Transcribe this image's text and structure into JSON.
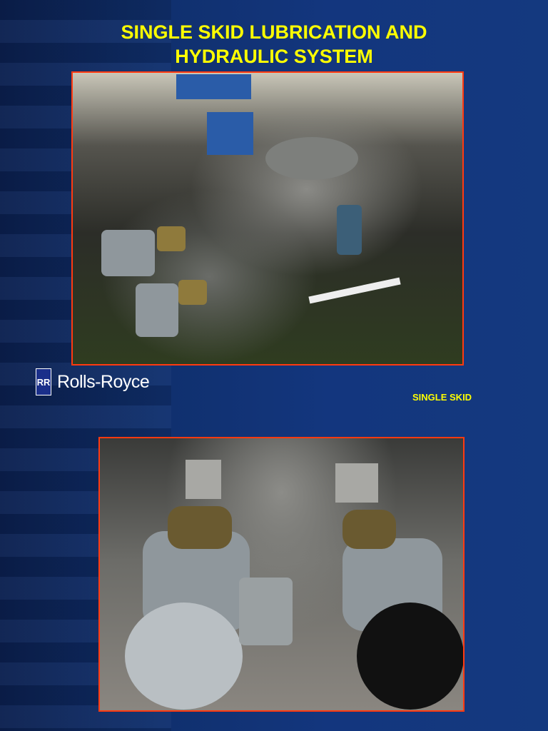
{
  "slide": {
    "title": "SINGLE SKID LUBRICATION  AND\nHYDRAULIC SYSTEM",
    "caption": "SINGLE SKID",
    "logo": {
      "badge": "RR",
      "text": "Rolls-Royce"
    }
  },
  "colors": {
    "title": "#ffff00",
    "frame": "#ff3a10",
    "background": "#13367e"
  }
}
